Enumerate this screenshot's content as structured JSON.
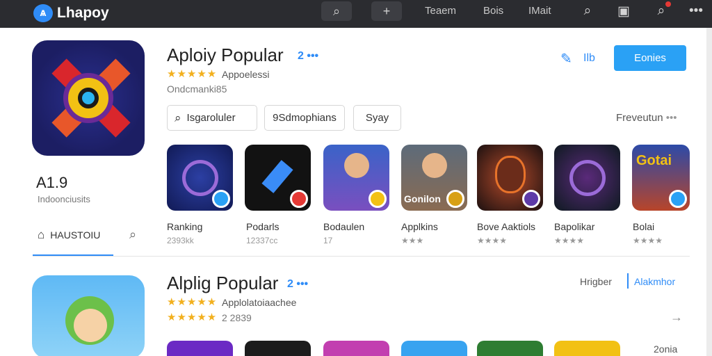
{
  "topbar": {
    "brand": "Lhapoy",
    "nav": [
      "Teaem",
      "Bois",
      "IMait"
    ]
  },
  "featured": {
    "title": "Aploiy Popular",
    "badge": "2 •••",
    "stars": "★★★★★",
    "developer": "Appoelessi",
    "category": "Ondcmanki85",
    "link_label": "Ilb",
    "primary_button": "Eonies",
    "rating": "A1.9",
    "rating_sub": "Indoonciusits",
    "filters": [
      "Isgaroluler",
      "9Sdmophians",
      "Syay"
    ],
    "filter_label": "Freveutun",
    "left_tab": "HAUSTOIU",
    "apps": [
      {
        "name": "Ranking",
        "sub": "2393kk"
      },
      {
        "name": "Podarls",
        "sub": "12337cc"
      },
      {
        "name": "Bodaulen",
        "sub": "17"
      },
      {
        "name": "Applkins",
        "sub": "★★★",
        "caption": "Gonilon"
      },
      {
        "name": "Bove Aaktiols",
        "sub": "★★★★"
      },
      {
        "name": "Bapolikar",
        "sub": "★★★★"
      },
      {
        "name": "Bolai",
        "sub": "★★★★",
        "caption": "Gotai"
      }
    ]
  },
  "section2": {
    "title": "Alplig Popular",
    "badge": "2 •••",
    "stars": "★★★★★",
    "developer": "Applolatoiaachee",
    "count": "2 2839",
    "link1": "Hrigber",
    "link2": "Alakmhor",
    "corner": "2onia"
  },
  "colors": {
    "accent": "#2f8cf7",
    "button": "#2aa1f5",
    "topbar": "#2b2c30",
    "star": "#f2b01e"
  }
}
